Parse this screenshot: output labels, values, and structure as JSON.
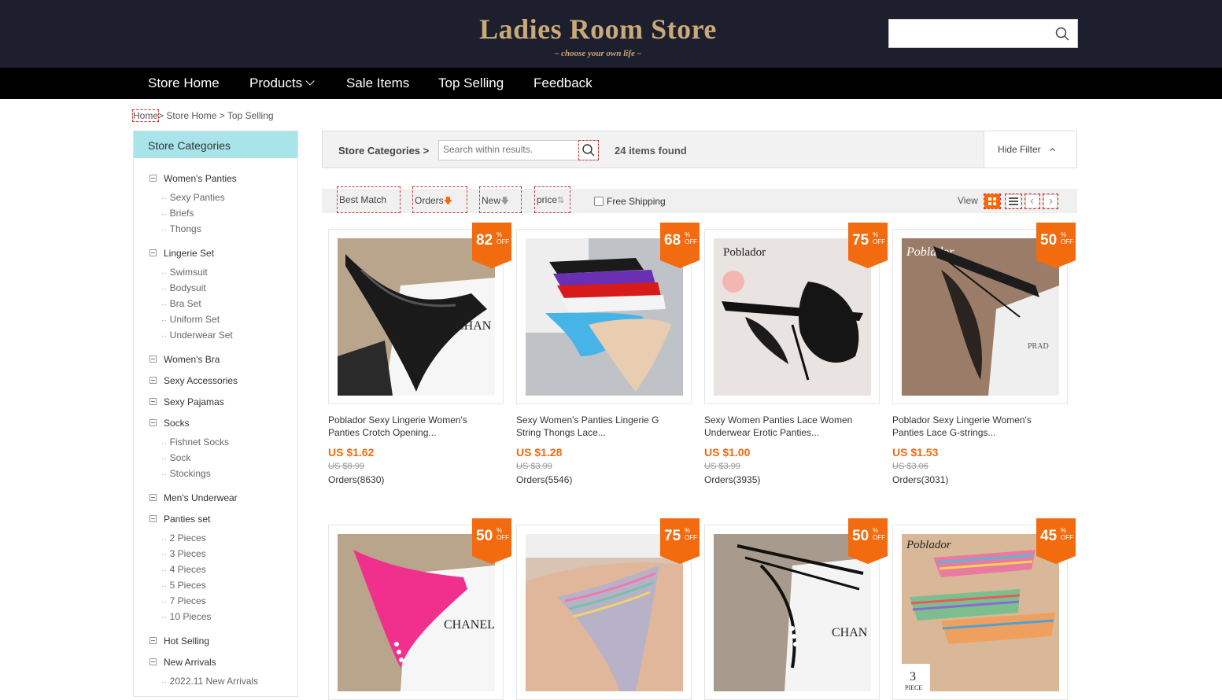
{
  "header": {
    "title": "Ladies Room Store",
    "subtitle": "– choose your own life –",
    "search_placeholder": ""
  },
  "nav": {
    "items": [
      "Store Home",
      "Products",
      "Sale Items",
      "Top Selling",
      "Feedback"
    ]
  },
  "breadcrumb": {
    "home": "Home",
    "rest": "> Store Home > Top Selling"
  },
  "sidebar": {
    "heading": "Store Categories",
    "categories": [
      {
        "label": "Women's Panties",
        "subs": [
          "Sexy Panties",
          "Briefs",
          "Thongs"
        ]
      },
      {
        "label": "Lingerie Set",
        "subs": [
          "Swimsuit",
          "Bodysuit",
          "Bra Set",
          "Uniform Set",
          "Underwear Set"
        ]
      },
      {
        "label": "Women's Bra",
        "subs": []
      },
      {
        "label": "Sexy Accessories",
        "subs": []
      },
      {
        "label": "Sexy Pajamas",
        "subs": []
      },
      {
        "label": "Socks",
        "subs": [
          "Fishnet Socks",
          "Sock",
          "Stockings"
        ]
      },
      {
        "label": "Men's Underwear",
        "subs": []
      },
      {
        "label": "Panties set",
        "subs": [
          "2 Pieces",
          "3 Pieces",
          "4 Pieces",
          "5 Pieces",
          "7 Pieces",
          "10 Pieces"
        ]
      },
      {
        "label": "Hot Selling",
        "subs": []
      },
      {
        "label": "New Arrivals",
        "subs": [
          "2022.11 New Arrivals"
        ]
      }
    ]
  },
  "results": {
    "label": "Store Categories >",
    "search_placeholder": "Search within results.",
    "count": "24 items found",
    "hide_filter": "Hide Filter"
  },
  "sort": {
    "best_match": "Best Match",
    "orders": "Orders",
    "new": "New",
    "price": "price",
    "free_shipping": "Free Shipping",
    "view_label": "View"
  },
  "accent_color": "#f26b0f",
  "products": [
    {
      "discount": "82",
      "title": "Poblador Sexy Lingerie Women's Panties Crotch Opening...",
      "price": "US $1.62",
      "old_price": "US $8.99",
      "orders": "Orders(8630)"
    },
    {
      "discount": "68",
      "title": "Sexy Women's Panties Lingerie G String Thongs Lace...",
      "price": "US $1.28",
      "old_price": "US $3.99",
      "orders": "Orders(5546)"
    },
    {
      "discount": "75",
      "title": "Sexy Women Panties Lace Women Underwear Erotic Panties...",
      "price": "US $1.00",
      "old_price": "US $3.99",
      "orders": "Orders(3935)"
    },
    {
      "discount": "50",
      "title": "Poblador Sexy Lingerie Women's Panties Lace G-strings...",
      "price": "US $1.53",
      "old_price": "US $3.06",
      "orders": "Orders(3031)"
    },
    {
      "discount": "50"
    },
    {
      "discount": "75"
    },
    {
      "discount": "50"
    },
    {
      "discount": "45"
    }
  ],
  "image_text": {
    "brand": "Poblador",
    "chanel_a": "CHAN",
    "chanel_b": "CHANEL",
    "prada": "PRAD",
    "piece_num": "3",
    "piece_word": "PIECE",
    "off": "OFF",
    "pct": "%"
  }
}
